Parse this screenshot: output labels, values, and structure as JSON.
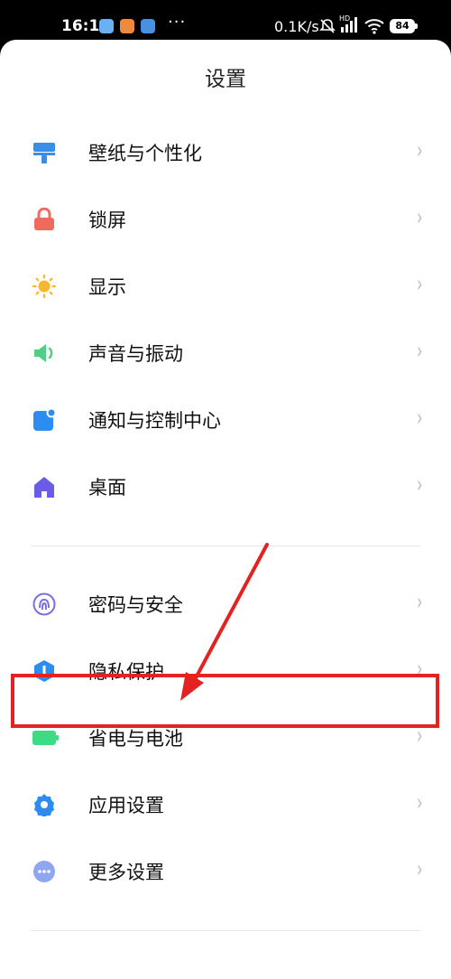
{
  "status_bar": {
    "time": "16:15",
    "dots": "···",
    "net_speed": "0.1K/s",
    "mute_icon": "bell-off-icon",
    "hd_signal_label": "HD",
    "wifi_icon": "wifi-icon",
    "battery_level": "84"
  },
  "header": {
    "title": "设置"
  },
  "group1": [
    {
      "label": "壁纸与个性化",
      "icon": "wallpaper-icon",
      "color": "#3a8ee6"
    },
    {
      "label": "锁屏",
      "icon": "lock-icon",
      "color": "#f06a5e"
    },
    {
      "label": "显示",
      "icon": "sun-icon",
      "color": "#f7b830"
    },
    {
      "label": "声音与振动",
      "icon": "speaker-icon",
      "color": "#4fcf82"
    },
    {
      "label": "通知与控制中心",
      "icon": "notification-icon",
      "color": "#2d8cf0"
    },
    {
      "label": "桌面",
      "icon": "home-icon",
      "color": "#6b5ce7"
    }
  ],
  "group2": [
    {
      "label": "密码与安全",
      "icon": "fingerprint-icon",
      "color": "#7a6fe0"
    },
    {
      "label": "隐私保护",
      "icon": "privacy-shield-icon",
      "color": "#2d8cf0"
    },
    {
      "label": "省电与电池",
      "icon": "battery-icon",
      "color": "#3ddc84"
    },
    {
      "label": "应用设置",
      "icon": "gear-icon",
      "color": "#2d8cf0"
    },
    {
      "label": "更多设置",
      "icon": "more-dots-icon",
      "color": "#8fa7f0"
    }
  ],
  "chevron": "›",
  "annotation": {
    "highlight_color": "#e32222"
  }
}
